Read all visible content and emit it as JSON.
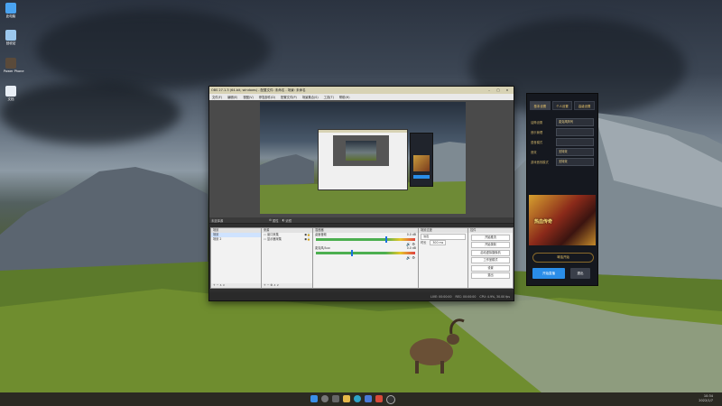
{
  "desktop": {
    "icons": [
      {
        "label": "此电脑",
        "color": "#4aa3f0"
      },
      {
        "label": "回收站",
        "color": "#9cc8ee"
      },
      {
        "label": "Power Phone",
        "color": "#5a4a3a"
      },
      {
        "label": "文档",
        "color": "#e8eef5"
      }
    ]
  },
  "obs": {
    "title": "OBS 27.1.3 (64-bit, windows) - 配置文件: 未命名 - 场景: 未命名",
    "menu": [
      "文件(F)",
      "编辑(E)",
      "视图(V)",
      "停靠部件(D)",
      "配置文件(P)",
      "场景集合(S)",
      "工具(T)",
      "帮助(H)"
    ],
    "dock_bar_left": "未选择源",
    "dock_bar_props": "属性",
    "dock_bar_filters": "滤镜",
    "scenes": {
      "title": "场景",
      "items": [
        "场景",
        "场景 2"
      ],
      "toolbar": "+ − ∧ ∨"
    },
    "sources": {
      "title": "来源",
      "items": [
        "窗口采集",
        "显示器采集"
      ],
      "toolbar": "+ − ⚙ ∧ ∨"
    },
    "mixer": {
      "title": "混音器",
      "channels": [
        {
          "name": "桌面音频",
          "db": "0.0 dB",
          "level": 0.7
        },
        {
          "name": "麦克风/Aux",
          "db": "0.0 dB",
          "level": 0.35
        }
      ]
    },
    "transitions": {
      "title": "场景过渡",
      "type": "淡出",
      "duration_label": "时长",
      "duration": "300 ms"
    },
    "controls": {
      "title": "控件",
      "buttons": [
        "开始推流",
        "开始录制",
        "启动虚拟摄像机",
        "工作室模式",
        "设置",
        "退出"
      ]
    },
    "status": {
      "live": "LIVE: 00:00:00",
      "rec": "REC: 00:00:00",
      "cpu": "CPU: 4.9%, 30.00 fps"
    }
  },
  "game_panel": {
    "tabs": [
      "基本设置",
      "个人设置",
      "高级设置"
    ],
    "rows": [
      {
        "key": "话筒设置",
        "value": "麦克风阵列"
      },
      {
        "key": "音乐管理",
        "value": ""
      },
      {
        "key": "语音模式",
        "value": ""
      },
      {
        "key": "音效",
        "value": "无特效"
      },
      {
        "key": "游戏音效模式",
        "value": "无特效"
      }
    ],
    "banner_text": "热血传奇",
    "speaker_label": "喊话开始",
    "btn_primary": "开始直播",
    "btn_secondary": "退出",
    "colors": {
      "primary": "#2a8de8",
      "secondary": "#3a3f4a",
      "accent": "#e8c46a"
    }
  },
  "taskbar": {
    "time": "10:34",
    "date": "2022/1/7",
    "pinned": [
      "windows-start-icon",
      "search-icon",
      "task-view-icon",
      "explorer-icon",
      "edge-icon",
      "store-icon",
      "app-icon",
      "obs-icon"
    ]
  }
}
